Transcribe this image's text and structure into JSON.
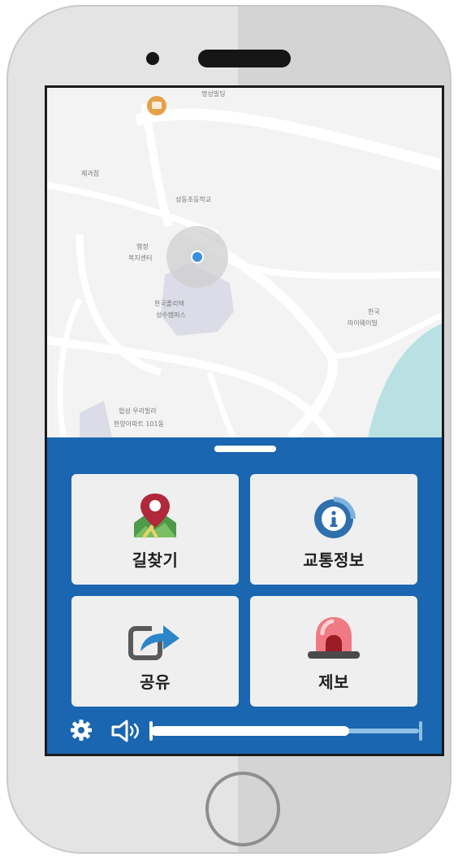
{
  "map": {
    "labels": [
      "제과점",
      "성동초등학교",
      "행정 복지센터",
      "한국폴리텍 성수캠퍼스",
      "한국 마이웨이빌",
      "협성 우리빌라 한양아파트 101동",
      "명성빌딩"
    ]
  },
  "tiles": [
    {
      "label": "길찾기",
      "icon": "map-pin-icon"
    },
    {
      "label": "교통정보",
      "icon": "info-icon"
    },
    {
      "label": "공유",
      "icon": "share-icon"
    },
    {
      "label": "제보",
      "icon": "siren-icon"
    }
  ],
  "volume": {
    "level": 0.74
  },
  "colors": {
    "panel": "#1a66b0",
    "tile": "#efefef",
    "accent_pin": "#b0283a",
    "info_blue": "#2f6fae"
  }
}
